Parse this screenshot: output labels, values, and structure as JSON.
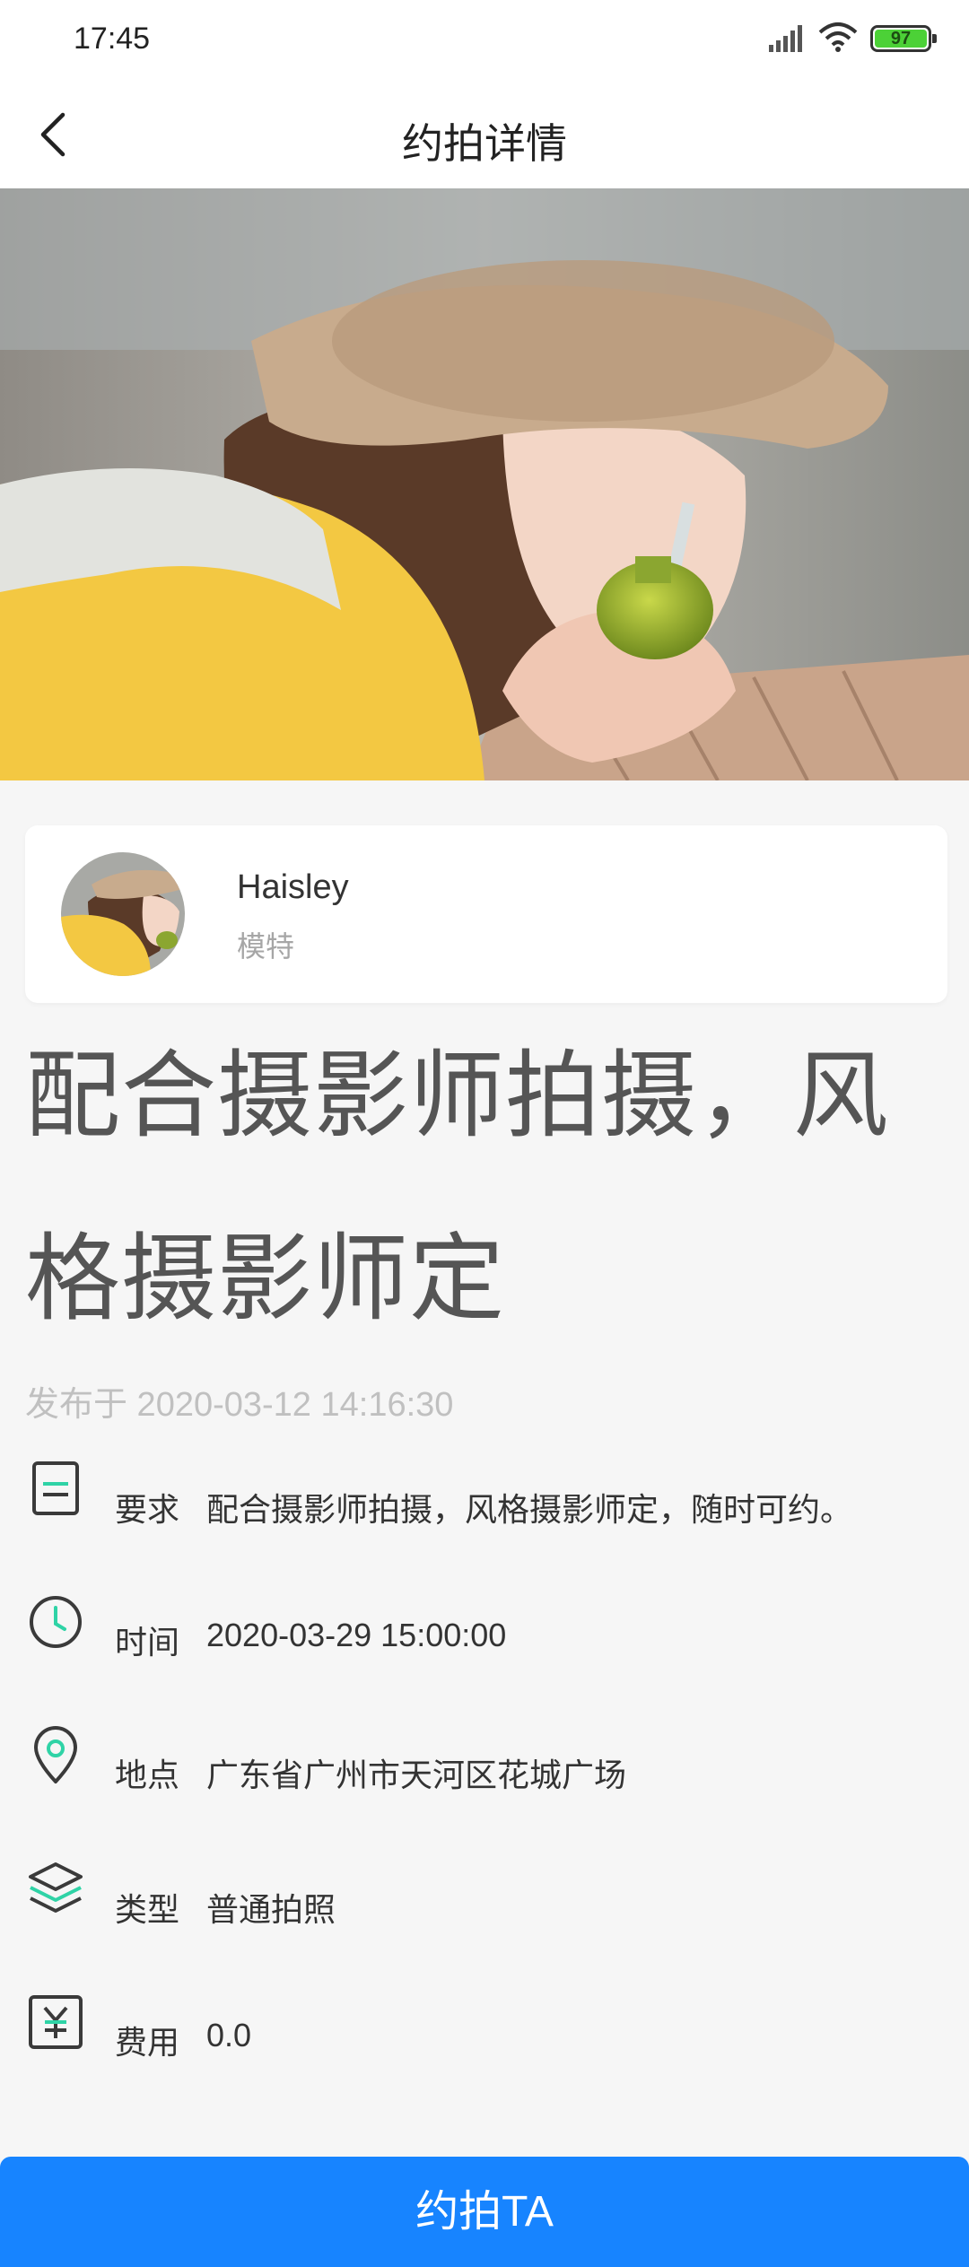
{
  "status_bar": {
    "time": "17:45",
    "battery": "97",
    "icons": [
      "signal-icon",
      "wifi-icon",
      "battery-icon"
    ]
  },
  "navbar": {
    "title": "约拍详情",
    "back_icon": "chevron-left-icon"
  },
  "profile": {
    "name": "Haisley",
    "role": "模特"
  },
  "post": {
    "title": "配合摄影师拍摄，风格摄影师定",
    "published": "发布于 2020-03-12 14:16:30"
  },
  "details": [
    {
      "icon": "requirement-icon",
      "label": "要求",
      "value": "配合摄影师拍摄，风格摄影师定，随时可约。"
    },
    {
      "icon": "clock-icon",
      "label": "时间",
      "value": "2020-03-29 15:00:00"
    },
    {
      "icon": "location-pin-icon",
      "label": "地点",
      "value": "广东省广州市天河区花城广场"
    },
    {
      "icon": "layers-icon",
      "label": "类型",
      "value": "普通拍照"
    },
    {
      "icon": "yen-icon",
      "label": "费用",
      "value": "0.0"
    }
  ],
  "cta_label": "约拍TA",
  "colors": {
    "accent_green": "#2fd3a6",
    "button_blue": "#1784ff",
    "background": "#f6f6f6"
  }
}
